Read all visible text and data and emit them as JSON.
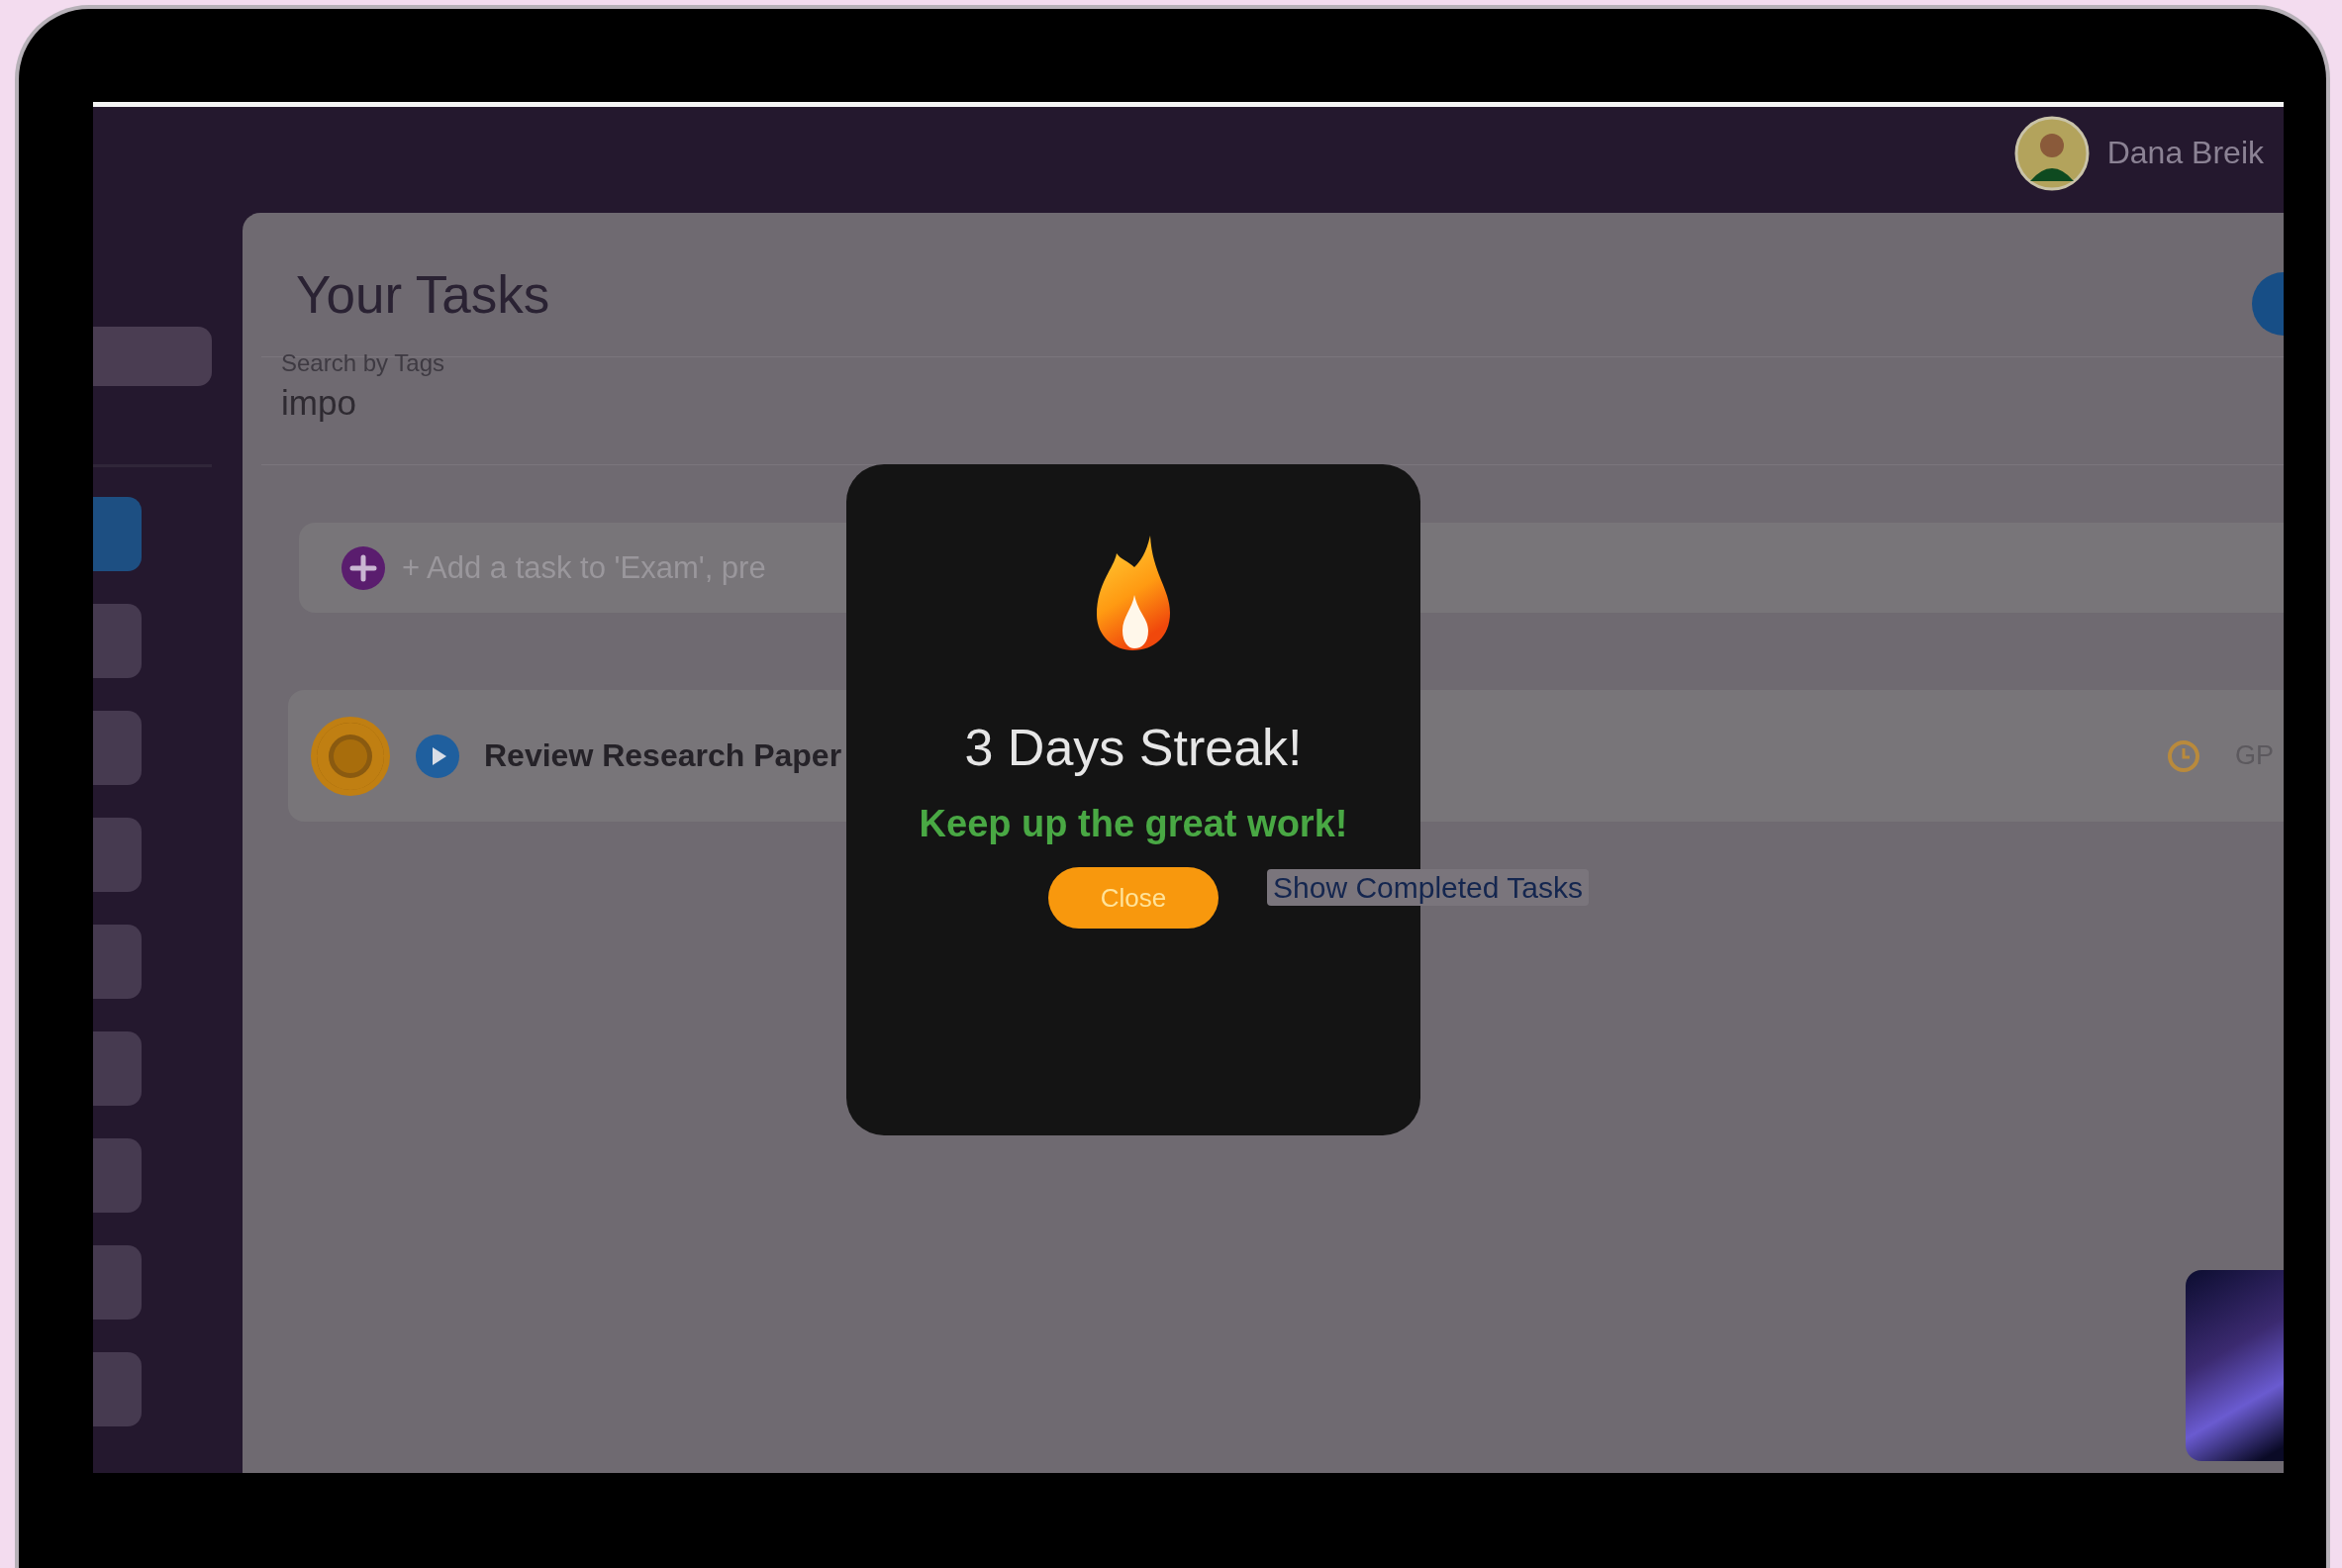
{
  "header": {
    "user_name": "Dana Breik"
  },
  "sidebar": {
    "items": [
      {
        "selected": true
      },
      {
        "selected": false
      },
      {
        "selected": false
      },
      {
        "selected": false
      },
      {
        "selected": false
      },
      {
        "selected": false
      },
      {
        "selected": false
      },
      {
        "selected": false
      },
      {
        "selected": false
      }
    ]
  },
  "page": {
    "title": "Your Tasks"
  },
  "search": {
    "label": "Search by Tags",
    "value": "impo"
  },
  "add_task": {
    "placeholder": "+ Add a task to 'Exam', pre"
  },
  "tasks": [
    {
      "title": "Review Research Paper",
      "trailing_text": "GP"
    }
  ],
  "show_completed_link": "Show Completed Tasks",
  "dialog": {
    "title": "3 Days Streak!",
    "message": "Keep up the great work!",
    "button": "Close"
  }
}
